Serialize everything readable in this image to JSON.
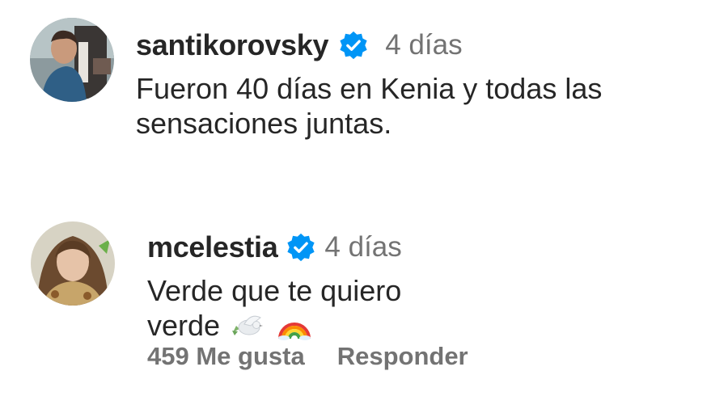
{
  "comments": [
    {
      "username": "santikorovsky",
      "time": "4 días",
      "text": "Fueron 40 días en Kenia y todas las sensaciones juntas.",
      "verified": true
    },
    {
      "username": "mcelestia",
      "time": "4 días",
      "text": "Verde que te quiero verde",
      "emojis": [
        "dove-emoji",
        "rainbow-emoji"
      ],
      "verified": true,
      "likes": "459 Me gusta",
      "reply": "Responder"
    }
  ],
  "colors": {
    "text": "#262626",
    "muted": "#737373",
    "verified": "#0095f6"
  }
}
